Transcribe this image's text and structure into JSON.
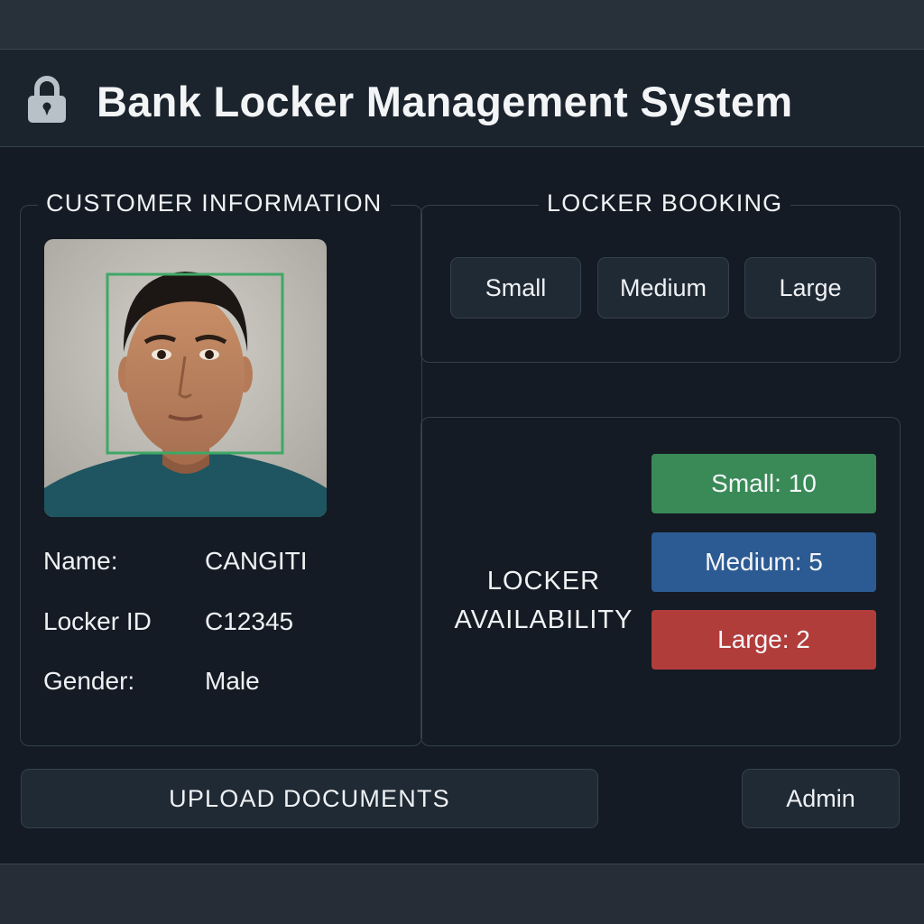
{
  "app": {
    "title": "Bank Locker Management System"
  },
  "customer": {
    "section_title": "CUSTOMER INFORMATION",
    "fields": [
      {
        "label": "Name:",
        "value": "CANGITI"
      },
      {
        "label": "Locker ID",
        "value": "C12345"
      },
      {
        "label": "Gender:",
        "value": "Male"
      }
    ]
  },
  "booking": {
    "section_title": "LOCKER BOOKING",
    "options": [
      "Small",
      "Medium",
      "Large"
    ]
  },
  "availability": {
    "label_line1": "LOCKER",
    "label_line2": "AVAILABILITY",
    "items": [
      {
        "text": "Small: 10",
        "color": "#3a8a57"
      },
      {
        "text": "Medium: 5",
        "color": "#2c5a93"
      },
      {
        "text": "Large: 2",
        "color": "#b13d3b"
      }
    ]
  },
  "actions": {
    "upload_label": "UPLOAD DOCUMENTS",
    "admin_label": "Admin"
  },
  "icons": {
    "header": "lock-icon",
    "face_frame": "face-detection-frame"
  }
}
